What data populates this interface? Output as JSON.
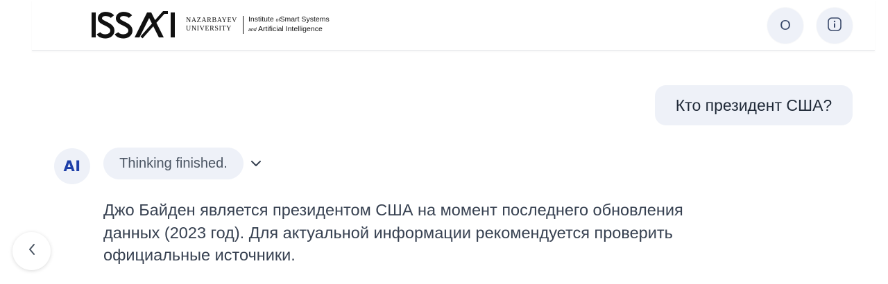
{
  "header": {
    "logo": {
      "mark": "ISSAI",
      "university_line1": "NAZARBAYEV",
      "university_line2": "UNIVERSITY",
      "institute_line1_a": "Institute",
      "institute_line1_b": "of",
      "institute_line1_c": "Smart Systems",
      "institute_line2_a": "and",
      "institute_line2_b": "Artificial Intelligence"
    },
    "user_button_label": "O",
    "info_icon": "info-icon"
  },
  "conversation": {
    "user_message": "Кто президент США?",
    "ai_avatar_label": "AI",
    "thinking_label": "Thinking finished.",
    "thinking_toggle_icon": "chevron-down-icon",
    "answer_text": "Джо Байден является президентом США на момент последнего обновления данных (2023 год). Для актуальной информации рекомендуется проверить официальные источники."
  },
  "sidebar": {
    "collapse_icon": "chevron-left-icon"
  },
  "colors": {
    "bubble_bg": "#eef1f8",
    "ai_accent": "#1e3fa8",
    "text": "#374151"
  }
}
